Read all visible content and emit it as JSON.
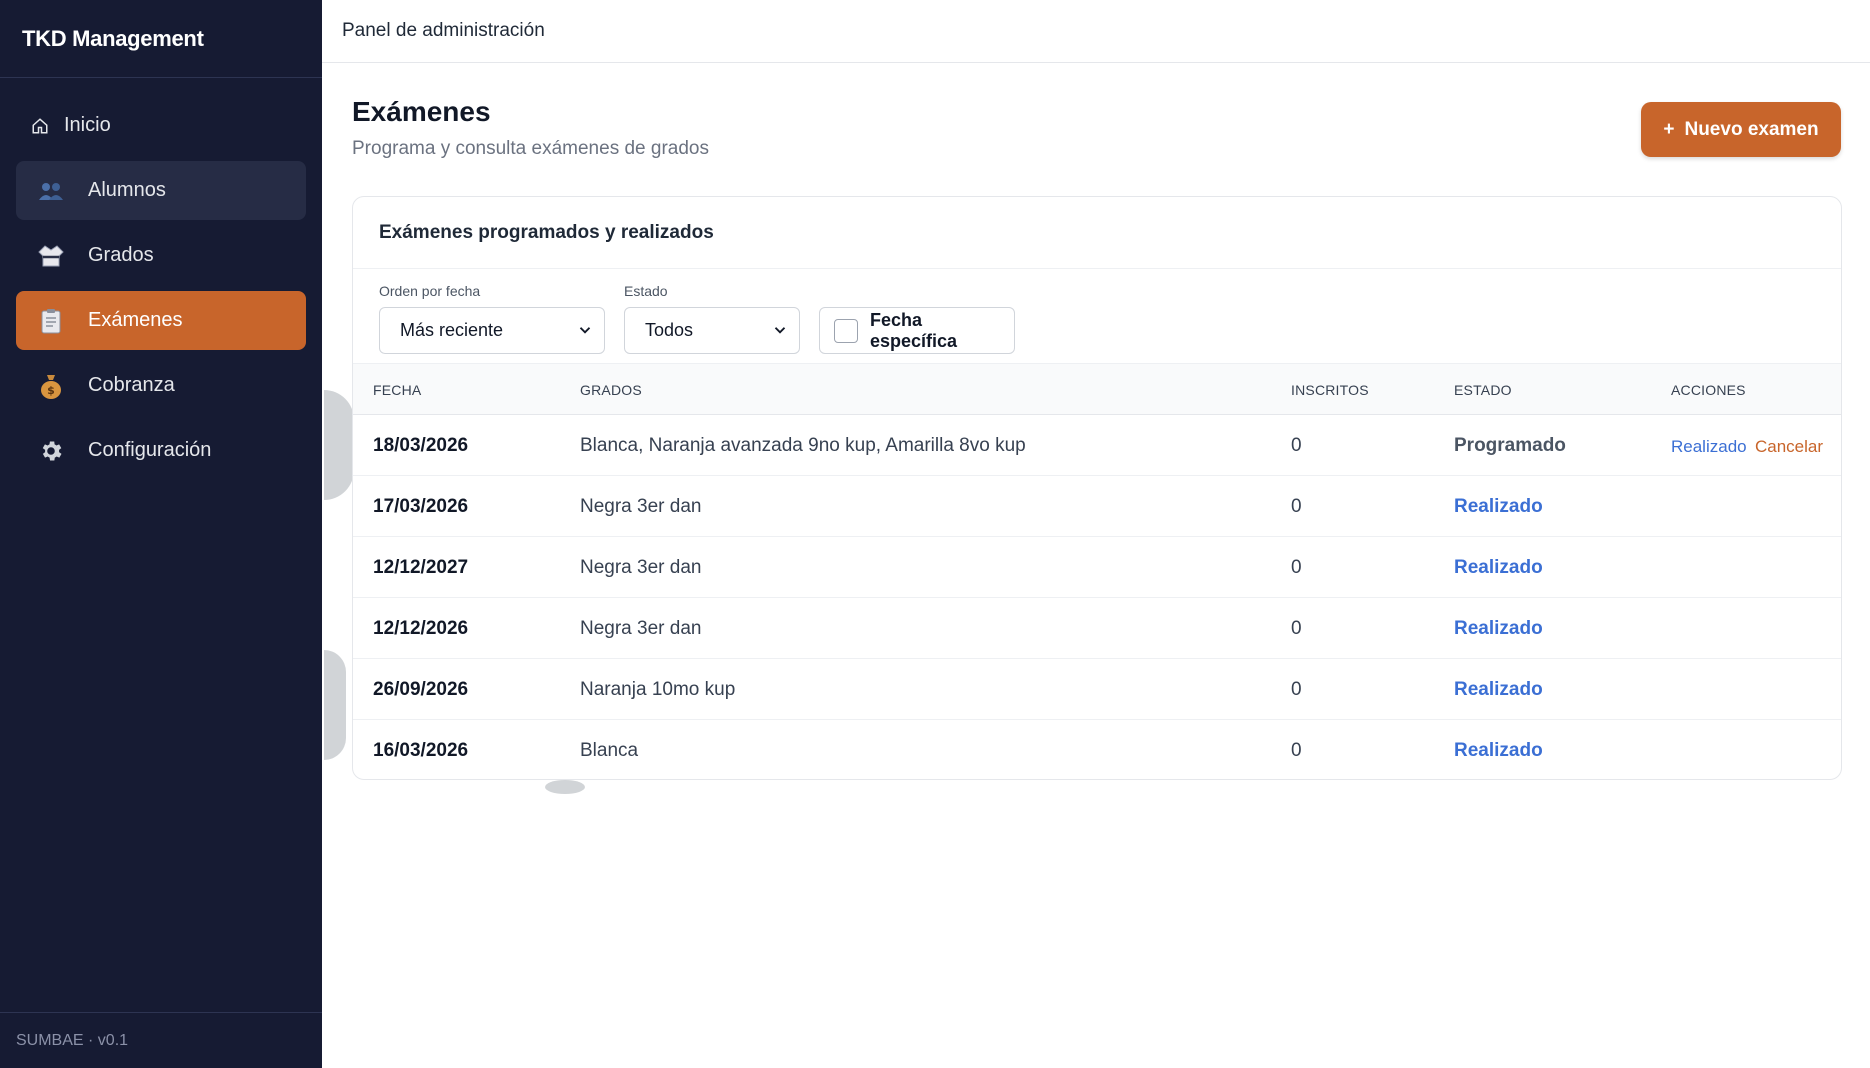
{
  "sidebar": {
    "brand": "TKD Management",
    "items": [
      {
        "label": "Inicio",
        "icon": "home-icon"
      },
      {
        "label": "Alumnos",
        "icon": "users-icon"
      },
      {
        "label": "Grados",
        "icon": "uniform-icon"
      },
      {
        "label": "Exámenes",
        "icon": "clipboard-icon"
      },
      {
        "label": "Cobranza",
        "icon": "money-bag-icon"
      },
      {
        "label": "Configuración",
        "icon": "gear-icon"
      }
    ],
    "footer": "SUMBAE · v0.1"
  },
  "topbar": {
    "title": "Panel de administración"
  },
  "page": {
    "title": "Exámenes",
    "subtitle": "Programa y consulta exámenes de grados",
    "new_button": "Nuevo examen",
    "new_button_icon": "+"
  },
  "card": {
    "title": "Exámenes programados y realizados",
    "filters": {
      "order_label": "Orden por fecha",
      "order_value": "Más reciente",
      "state_label": "Estado",
      "state_value": "Todos",
      "date_checkbox": "Fecha específica"
    },
    "columns": [
      "FECHA",
      "GRADOS",
      "INSCRITOS",
      "ESTADO",
      "ACCIONES"
    ],
    "rows": [
      {
        "date": "18/03/2026",
        "grades": "Blanca, Naranja avanzada 9no kup, Amarilla 8vo kup",
        "enrolled": "0",
        "state": "Programado",
        "action1": "Realizado",
        "action2": "Cancelar"
      },
      {
        "date": "17/03/2026",
        "grades": "Negra 3er dan",
        "enrolled": "0",
        "state": "Realizado"
      },
      {
        "date": "12/12/2027",
        "grades": "Negra 3er dan",
        "enrolled": "0",
        "state": "Realizado"
      },
      {
        "date": "12/12/2026",
        "grades": "Negra 3er dan",
        "enrolled": "0",
        "state": "Realizado"
      },
      {
        "date": "26/09/2026",
        "grades": "Naranja 10mo kup",
        "enrolled": "0",
        "state": "Realizado"
      },
      {
        "date": "16/03/2026",
        "grades": "Blanca",
        "enrolled": "0",
        "state": "Realizado"
      }
    ]
  },
  "colors": {
    "sidebar_bg": "#161b33",
    "accent": "#c8652b",
    "link_blue": "#3b6fd4"
  }
}
